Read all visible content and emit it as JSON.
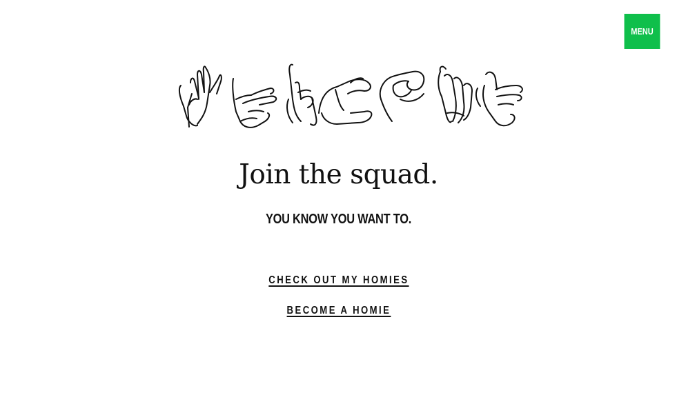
{
  "header": {
    "menu_label": "MENU",
    "accent_color": "#0fbf4b"
  },
  "hero": {
    "art_icon": "sign-language-welcome-hands-illustration",
    "headline": "Join the squad.",
    "subhead": "YOU KNOW YOU WANT TO."
  },
  "actions": {
    "homies_label": "CHECK OUT MY HOMIES",
    "become_label": "BECOME A HOMIE"
  }
}
